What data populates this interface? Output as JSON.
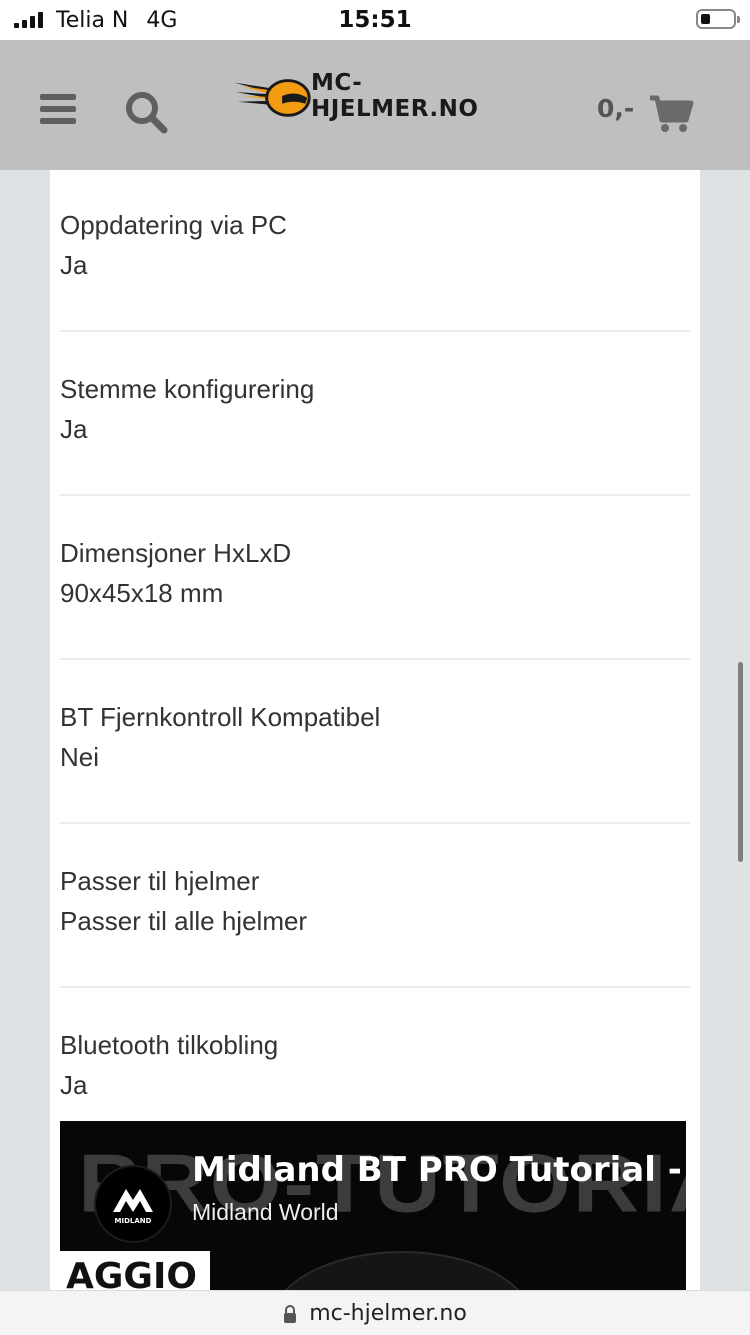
{
  "status_bar": {
    "carrier": "Telia N",
    "network": "4G",
    "time": "15:51"
  },
  "header": {
    "logo_text": "MC-HJELMER.NO",
    "cart_total": "0,-",
    "icons": [
      "menu-icon",
      "search-icon",
      "helmet-logo-icon",
      "cart-icon"
    ],
    "colors": {
      "header_bg": "#bfbfbf",
      "logo_accent": "#f39c12",
      "icon": "#5f5f5f"
    }
  },
  "specs": [
    {
      "label": "Oppdatering via PC",
      "value": "Ja"
    },
    {
      "label": "Stemme konfigurering",
      "value": "Ja"
    },
    {
      "label": "Dimensjoner HxLxD",
      "value": "90x45x18 mm"
    },
    {
      "label": "BT Fjernkontroll Kompatibel",
      "value": "Nei"
    },
    {
      "label": "Passer til hjelmer",
      "value": "Passer til alle hjelmer"
    },
    {
      "label": "Bluetooth tilkobling",
      "value": "Ja"
    }
  ],
  "video": {
    "title": "Midland BT PRO Tutorial -",
    "channel": "Midland World",
    "background_text": "PRO-TUTORIAL",
    "avatar_text": "MIDLAND",
    "thumbnail_text": "AGGIO"
  },
  "browser": {
    "url": "mc-hjelmer.no"
  }
}
